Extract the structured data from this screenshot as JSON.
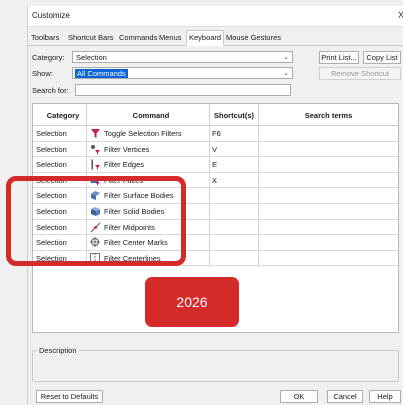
{
  "window": {
    "title": "Customize",
    "close_glyph": "X"
  },
  "tabs": [
    {
      "label": "Toolbars"
    },
    {
      "label": "Shortcut Bars"
    },
    {
      "label": "Commands"
    },
    {
      "label": "Menus"
    },
    {
      "label": "Keyboard",
      "active": true
    },
    {
      "label": "Mouse Gestures"
    }
  ],
  "filters": {
    "category_label": "Category:",
    "category_value": "Selection",
    "show_label": "Show:",
    "show_value": "All Commands",
    "search_label": "Search for:",
    "search_value": ""
  },
  "buttons": {
    "print_list": "Print List...",
    "copy_list": "Copy List",
    "remove_shortcut": "Remove Shortcut",
    "reset": "Reset to Defaults",
    "ok": "OK",
    "cancel": "Cancel",
    "help": "Help"
  },
  "table": {
    "columns": [
      "Category",
      "Command",
      "Shortcut(s)",
      "Search terms"
    ],
    "rows": [
      {
        "category": "Selection",
        "command": "Toggle Selection Filters",
        "shortcut": "F6",
        "search": "",
        "icon": "funnel-icon"
      },
      {
        "category": "Selection",
        "command": "Filter Vertices",
        "shortcut": "V",
        "search": "",
        "icon": "filter-vertices-icon"
      },
      {
        "category": "Selection",
        "command": "Filter Edges",
        "shortcut": "E",
        "search": "",
        "icon": "filter-edges-icon"
      },
      {
        "category": "Selection",
        "command": "Filter Faces",
        "shortcut": "X",
        "search": "",
        "icon": "filter-faces-icon"
      },
      {
        "category": "Selection",
        "command": "Filter Surface Bodies",
        "shortcut": "",
        "search": "",
        "icon": "filter-surface-bodies-icon"
      },
      {
        "category": "Selection",
        "command": "Filter Solid Bodies",
        "shortcut": "",
        "search": "",
        "icon": "filter-solid-bodies-icon"
      },
      {
        "category": "Selection",
        "command": "Filter Midpoints",
        "shortcut": "",
        "search": "",
        "icon": "filter-midpoints-icon"
      },
      {
        "category": "Selection",
        "command": "Filter Center Marks",
        "shortcut": "",
        "search": "",
        "icon": "filter-center-marks-icon"
      },
      {
        "category": "Selection",
        "command": "Filter Centerlines",
        "shortcut": "",
        "search": "",
        "icon": "filter-centerlines-icon"
      }
    ]
  },
  "description_label": "Description",
  "badge": {
    "text": "2026"
  },
  "colors": {
    "accent": "#d42a2a",
    "selection": "#0a64d8"
  }
}
